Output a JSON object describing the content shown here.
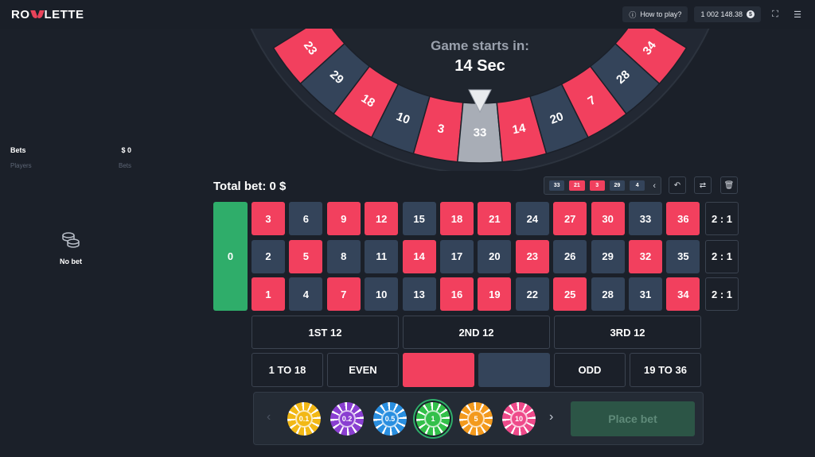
{
  "header": {
    "logo": "ROULETTE",
    "how_to_play": "How to play?",
    "balance": "1 002 148.38",
    "balance_currency_icon": "dollar-coin-icon",
    "fullscreen_icon": "fullscreen-icon",
    "menu_icon": "hamburger-icon"
  },
  "left_panel": {
    "bets_label": "Bets",
    "bets_value": "$ 0",
    "players_label": "Players",
    "bets_col_label": "Bets",
    "no_bet_label": "No bet"
  },
  "wheel": {
    "countdown_label": "Game starts in:",
    "countdown_value": "14 Sec",
    "numbers": [
      {
        "n": "23",
        "c": "red"
      },
      {
        "n": "29",
        "c": "dark"
      },
      {
        "n": "18",
        "c": "red"
      },
      {
        "n": "10",
        "c": "dark"
      },
      {
        "n": "3",
        "c": "red"
      },
      {
        "n": "33",
        "c": "active"
      },
      {
        "n": "14",
        "c": "red"
      },
      {
        "n": "20",
        "c": "dark"
      },
      {
        "n": "7",
        "c": "red"
      },
      {
        "n": "28",
        "c": "dark"
      },
      {
        "n": "34",
        "c": "red"
      }
    ]
  },
  "controls": {
    "total_bet": "Total bet: 0 $",
    "history": [
      {
        "n": "33",
        "c": "dark"
      },
      {
        "n": "21",
        "c": "red"
      },
      {
        "n": "3",
        "c": "red"
      },
      {
        "n": "29",
        "c": "dark"
      },
      {
        "n": "4",
        "c": "dark"
      }
    ]
  },
  "board": {
    "zero": "0",
    "rows": [
      [
        {
          "n": "3",
          "c": "red"
        },
        {
          "n": "6",
          "c": "dark"
        },
        {
          "n": "9",
          "c": "red"
        },
        {
          "n": "12",
          "c": "red"
        },
        {
          "n": "15",
          "c": "dark"
        },
        {
          "n": "18",
          "c": "red"
        },
        {
          "n": "21",
          "c": "red"
        },
        {
          "n": "24",
          "c": "dark"
        },
        {
          "n": "27",
          "c": "red"
        },
        {
          "n": "30",
          "c": "red"
        },
        {
          "n": "33",
          "c": "dark"
        },
        {
          "n": "36",
          "c": "red"
        }
      ],
      [
        {
          "n": "2",
          "c": "dark"
        },
        {
          "n": "5",
          "c": "red"
        },
        {
          "n": "8",
          "c": "dark"
        },
        {
          "n": "11",
          "c": "dark"
        },
        {
          "n": "14",
          "c": "red"
        },
        {
          "n": "17",
          "c": "dark"
        },
        {
          "n": "20",
          "c": "dark"
        },
        {
          "n": "23",
          "c": "red"
        },
        {
          "n": "26",
          "c": "dark"
        },
        {
          "n": "29",
          "c": "dark"
        },
        {
          "n": "32",
          "c": "red"
        },
        {
          "n": "35",
          "c": "dark"
        }
      ],
      [
        {
          "n": "1",
          "c": "red"
        },
        {
          "n": "4",
          "c": "dark"
        },
        {
          "n": "7",
          "c": "red"
        },
        {
          "n": "10",
          "c": "dark"
        },
        {
          "n": "13",
          "c": "dark"
        },
        {
          "n": "16",
          "c": "red"
        },
        {
          "n": "19",
          "c": "red"
        },
        {
          "n": "22",
          "c": "dark"
        },
        {
          "n": "25",
          "c": "red"
        },
        {
          "n": "28",
          "c": "dark"
        },
        {
          "n": "31",
          "c": "dark"
        },
        {
          "n": "34",
          "c": "red"
        }
      ]
    ],
    "column_bets": [
      "2 : 1",
      "2 : 1",
      "2 : 1"
    ],
    "dozens": [
      "1ST 12",
      "2ND 12",
      "3RD 12"
    ],
    "outside": [
      "1 TO 18",
      "EVEN",
      "",
      "",
      "ODD",
      "19 TO 36"
    ]
  },
  "chips": {
    "values": [
      {
        "v": "0.1",
        "color": "#f2b816"
      },
      {
        "v": "0.2",
        "color": "#8a3fd1"
      },
      {
        "v": "0.5",
        "color": "#2a8fe0"
      },
      {
        "v": "1",
        "color": "#33c04a",
        "selected": true
      },
      {
        "v": "5",
        "color": "#f39a1e"
      },
      {
        "v": "10",
        "color": "#ee4a8a"
      }
    ],
    "place_bet": "Place bet"
  },
  "colors": {
    "red": "#f2405e",
    "dark": "#34445a",
    "green": "#2fad6a",
    "background": "#1b2029"
  }
}
